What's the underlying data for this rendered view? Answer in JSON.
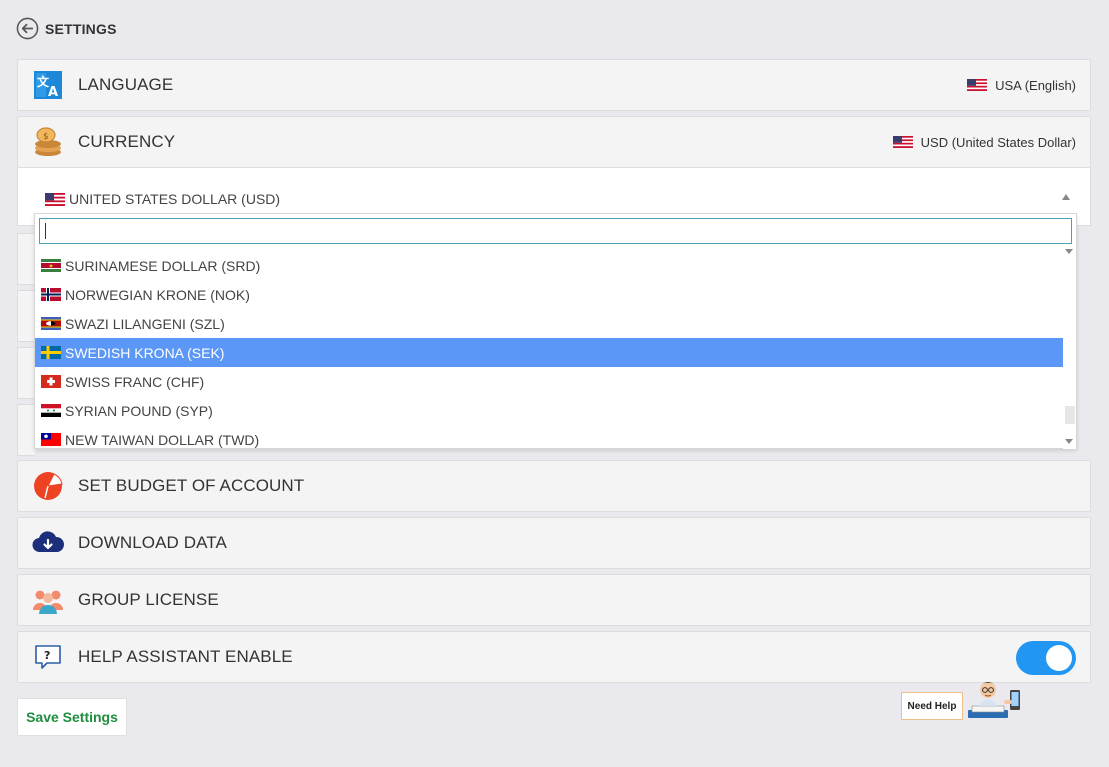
{
  "header": {
    "title": "SETTINGS"
  },
  "panels": {
    "language": {
      "label": "LANGUAGE",
      "value": "USA (English)"
    },
    "currency": {
      "label": "CURRENCY",
      "value": "USD (United States Dollar)"
    },
    "budget": {
      "label": "SET BUDGET OF ACCOUNT"
    },
    "download": {
      "label": "DOWNLOAD DATA"
    },
    "group": {
      "label": "GROUP LICENSE"
    },
    "help": {
      "label": "HELP ASSISTANT ENABLE",
      "enabled": true
    }
  },
  "currency_select": {
    "selected": "UNITED STATES DOLLAR (USD)",
    "search_value": "",
    "options": [
      "SURINAMESE DOLLAR (SRD)",
      "NORWEGIAN KRONE (NOK)",
      "SWAZI LILANGENI (SZL)",
      "SWEDISH KRONA (SEK)",
      "SWISS FRANC (CHF)",
      "SYRIAN POUND (SYP)",
      "NEW TAIWAN DOLLAR (TWD)"
    ],
    "highlighted": "SWEDISH KRONA (SEK)"
  },
  "buttons": {
    "save": "Save Settings",
    "need_help": "Need Help"
  },
  "colors": {
    "accent": "#2196f3",
    "highlight": "#5b97f7",
    "save_text": "#1e8e3e"
  }
}
